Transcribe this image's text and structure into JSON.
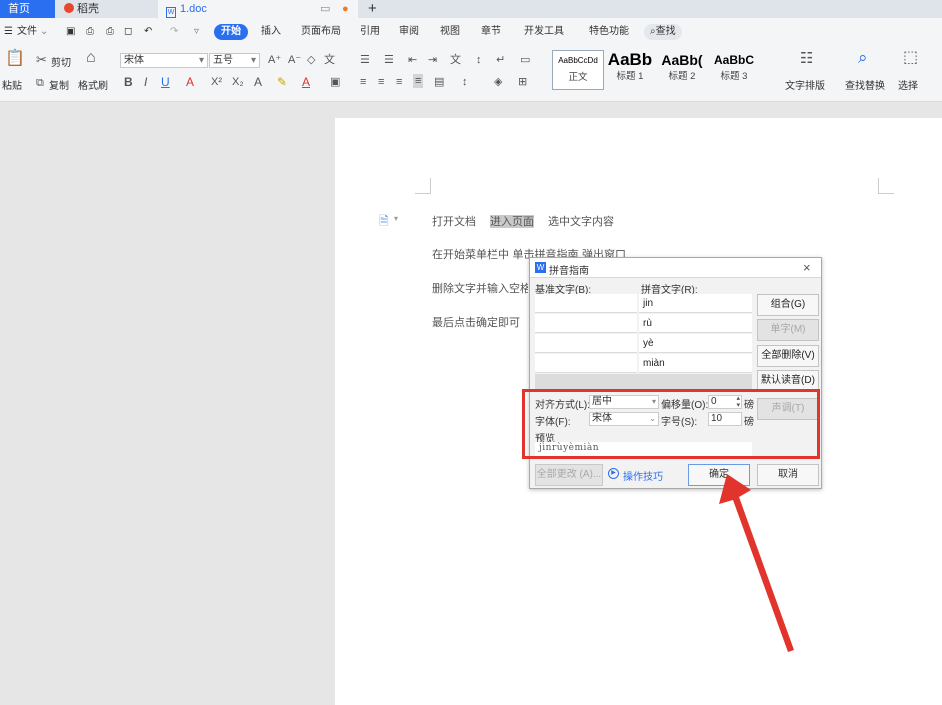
{
  "tabs": {
    "home": "首页",
    "daoke": "稻壳",
    "doc": "1.doc",
    "plus": "+"
  },
  "menubar": {
    "file": "文件",
    "items": [
      "开始",
      "插入",
      "页面布局",
      "引用",
      "审阅",
      "视图",
      "章节",
      "开发工具",
      "特色功能"
    ],
    "search": "查找"
  },
  "ribbon": {
    "paste": "粘贴",
    "cut": "剪切",
    "copy": "复制",
    "format_painter": "格式刷",
    "font_name": "宋体",
    "font_size": "五号",
    "styles": [
      {
        "preview": "AaBbCcDd",
        "name": "正文"
      },
      {
        "preview": "AaBb",
        "name": "标题 1"
      },
      {
        "preview": "AaBb(",
        "name": "标题 2"
      },
      {
        "preview": "AaBbC",
        "name": "标题 3"
      }
    ],
    "text_layout": "文字排版",
    "find_replace": "查找替换",
    "select": "选择"
  },
  "document": {
    "line1_a": "打开文档",
    "line1_b": "进入页面",
    "line1_c": "选中文字内容",
    "line2": "在开始菜单栏中   单击拼音指南   弹出窗口",
    "line3": "删除文字并输入空格",
    "line4": "最后点击确定即可"
  },
  "dialog": {
    "title": "拼音指南",
    "close": "×",
    "base_header": "基准文字(B):",
    "ruby_header": "拼音文字(R):",
    "ruby_rows": [
      "jin",
      "rù",
      "yè",
      "miàn"
    ],
    "buttons": {
      "combine": "组合(G)",
      "single": "单字(M)",
      "clear_all": "全部删除(V)",
      "default": "默认读音(D)",
      "tone": "声调(T)",
      "apply_all": "全部更改 (A)...",
      "tips": "操作技巧",
      "ok": "确定",
      "cancel": "取消"
    },
    "align_label": "对齐方式(L):",
    "align_value": "居中",
    "offset_label": "偏移量(O):",
    "offset_value": "0",
    "offset_unit": "磅",
    "font_label": "字体(F):",
    "font_value": "宋体",
    "size_label": "字号(S):",
    "size_value": "10",
    "size_unit": "磅",
    "preview_label": "预览",
    "preview_text": "jìnrùyèmiàn"
  },
  "colors": {
    "accent": "#2a6ff0",
    "annotation": "#e0342c"
  }
}
